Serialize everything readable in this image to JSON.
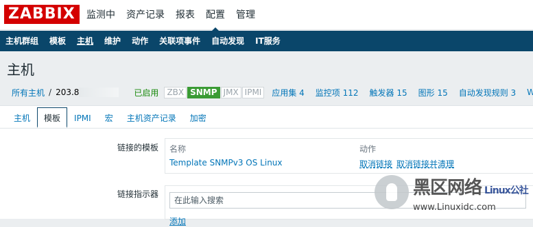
{
  "brand": {
    "logo": "ZABBIX"
  },
  "top_nav": [
    "监测中",
    "资产记录",
    "报表",
    "配置",
    "管理"
  ],
  "top_nav_active": "配置",
  "sub_nav": [
    "主机群组",
    "模板",
    "主机",
    "维护",
    "动作",
    "关联项事件",
    "自动发现",
    "IT服务"
  ],
  "sub_nav_active": "主机",
  "page_title": "主机",
  "breadcrumb": {
    "all_hosts": "所有主机",
    "separator": "/",
    "host_name": "203.8",
    "status": "已启用",
    "tags": [
      "ZBX",
      "SNMP",
      "JMX",
      "IPMI"
    ],
    "active_tag": "SNMP",
    "stats": [
      "应用集 4",
      "监控项 112",
      "触发器 15",
      "图形 15",
      "自动发现规则 3",
      "We"
    ]
  },
  "tabs": [
    "主机",
    "模板",
    "IPMI",
    "宏",
    "主机资产记录",
    "加密"
  ],
  "active_tab": "模板",
  "linked_templates": {
    "label": "链接的模板",
    "col_name": "名称",
    "col_action": "动作",
    "rows": [
      {
        "name": "Template SNMPv3 OS Linux",
        "unlink": "取消链接",
        "unlink_clear": "取消链接并清理"
      }
    ]
  },
  "link_indicator": {
    "label": "链接指示器",
    "search_placeholder": "在此输入搜索",
    "add_label": "添加"
  },
  "watermark": {
    "line1_cn": "黑区网络",
    "line1_latin": "Linux公社",
    "line2": "www.Linuxidc.com"
  },
  "colors": {
    "brand_red": "#d40000",
    "nav_blue": "#0a466a",
    "link_blue": "#0275b8",
    "enabled_green": "#1b8a0e",
    "tag_green": "#3a9b34"
  }
}
